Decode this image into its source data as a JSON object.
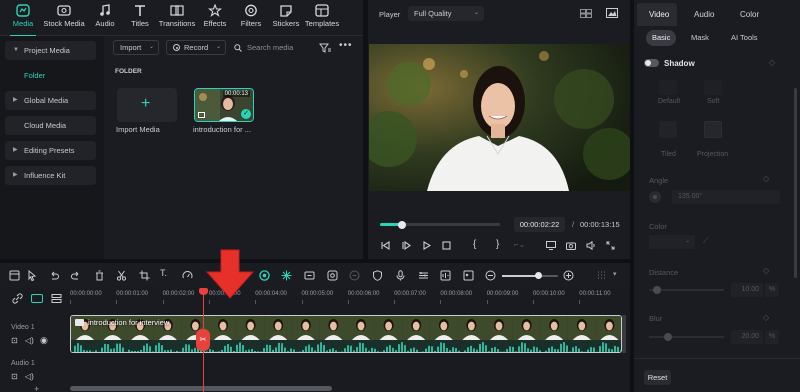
{
  "media_tabs": [
    {
      "label": "Media",
      "icon": "media-icon",
      "active": true
    },
    {
      "label": "Stock Media",
      "icon": "stock-media-icon"
    },
    {
      "label": "Audio",
      "icon": "audio-icon"
    },
    {
      "label": "Titles",
      "icon": "titles-icon"
    },
    {
      "label": "Transitions",
      "icon": "transitions-icon"
    },
    {
      "label": "Effects",
      "icon": "effects-icon"
    },
    {
      "label": "Filters",
      "icon": "filters-icon"
    },
    {
      "label": "Stickers",
      "icon": "stickers-icon"
    },
    {
      "label": "Templates",
      "icon": "templates-icon"
    }
  ],
  "sidebar": {
    "items": [
      {
        "label": "Project Media"
      },
      {
        "label": "Folder"
      },
      {
        "label": "Global Media"
      },
      {
        "label": "Cloud Media"
      },
      {
        "label": "Editing Presets"
      },
      {
        "label": "Influence Kit"
      }
    ]
  },
  "media": {
    "import_label": "Import",
    "record_label": "Record",
    "search_placeholder": "Search media",
    "folder_heading": "FOLDER",
    "import_tile_label": "Import Media",
    "clip_label": "introduction for ...",
    "clip_duration": "00:00:13"
  },
  "player": {
    "label": "Player",
    "quality": "Full Quality",
    "current_time": "00:00:02:22",
    "separator": "/",
    "total_time": "00:00:13:15",
    "progress": 0.18
  },
  "props": {
    "tabs": [
      "Video",
      "Audio",
      "Color"
    ],
    "subtabs": [
      "Basic",
      "Mask",
      "AI Tools"
    ],
    "shadow_label": "Shadow",
    "shadow_options": [
      "Default",
      "Soft",
      "Tiled",
      "Projection"
    ],
    "angle_label": "Angle",
    "angle_value": "135.00°",
    "color_label": "Color",
    "distance_label": "Distance",
    "distance_value": "10.00",
    "distance_unit": "%",
    "blur_label": "Blur",
    "blur_value": "20.00",
    "blur_unit": "%",
    "reset_label": "Reset"
  },
  "timeline": {
    "ruler": [
      "00:00:00:00",
      "00:00:01:00",
      "00:00:02:00",
      "00:00:03:00",
      "00:00:04:00",
      "00:00:05:00",
      "00:00:06:00",
      "00:00:07:00",
      "00:00:08:00",
      "00:00:09:00",
      "00:00:10:00",
      "00:00:11:00"
    ],
    "video_track_label": "Video 1",
    "audio_track_label": "Audio 1",
    "clip_title": "introduction for interview"
  },
  "colors": {
    "accent": "#27d6b9",
    "playhead": "#e8423c",
    "arrow": "#e8302a"
  }
}
